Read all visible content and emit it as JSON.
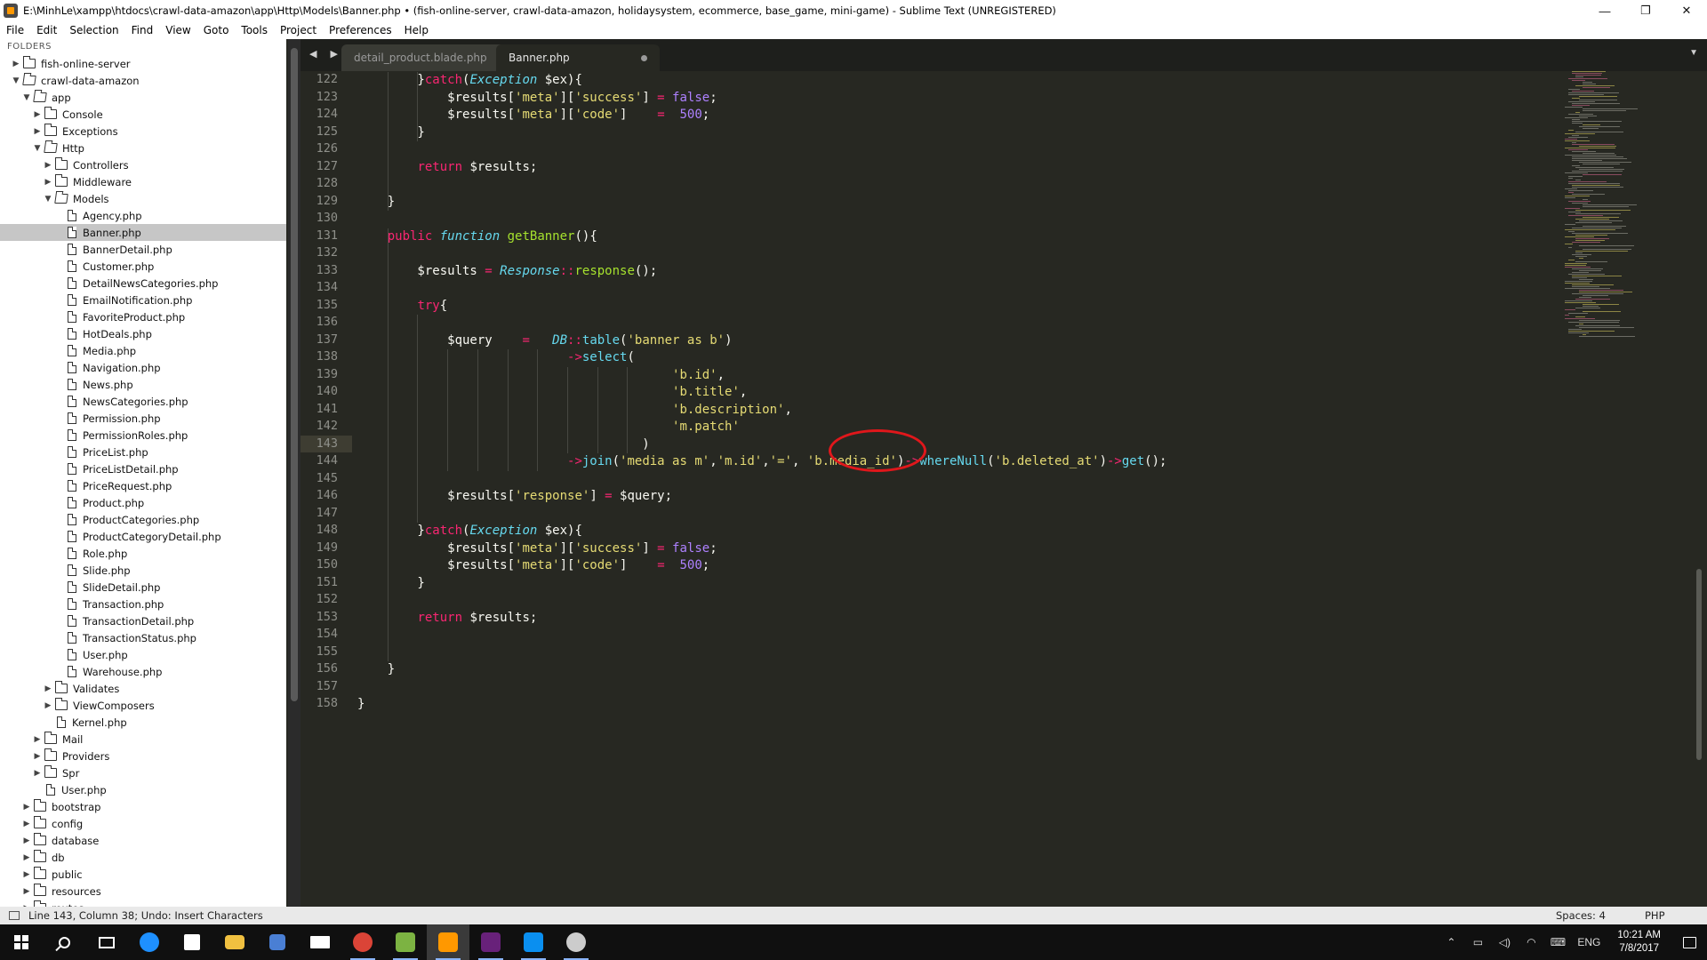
{
  "window": {
    "title": "E:\\MinhLe\\xampp\\htdocs\\crawl-data-amazon\\app\\Http\\Models\\Banner.php • (fish-online-server, crawl-data-amazon, holidaysystem, ecommerce, base_game, mini-game) - Sublime Text (UNREGISTERED)",
    "controls": {
      "minimize": "—",
      "restore": "❐",
      "close": "✕"
    }
  },
  "menu": [
    "File",
    "Edit",
    "Selection",
    "Find",
    "View",
    "Goto",
    "Tools",
    "Project",
    "Preferences",
    "Help"
  ],
  "sidebar": {
    "header": "FOLDERS",
    "tree": [
      {
        "label": "fish-online-server",
        "type": "folder",
        "depth": 0,
        "open": false
      },
      {
        "label": "crawl-data-amazon",
        "type": "folder",
        "depth": 0,
        "open": true
      },
      {
        "label": "app",
        "type": "folder",
        "depth": 1,
        "open": true
      },
      {
        "label": "Console",
        "type": "folder",
        "depth": 2,
        "open": false
      },
      {
        "label": "Exceptions",
        "type": "folder",
        "depth": 2,
        "open": false
      },
      {
        "label": "Http",
        "type": "folder",
        "depth": 2,
        "open": true
      },
      {
        "label": "Controllers",
        "type": "folder",
        "depth": 3,
        "open": false
      },
      {
        "label": "Middleware",
        "type": "folder",
        "depth": 3,
        "open": false
      },
      {
        "label": "Models",
        "type": "folder",
        "depth": 3,
        "open": true
      },
      {
        "label": "Agency.php",
        "type": "file",
        "depth": 4
      },
      {
        "label": "Banner.php",
        "type": "file",
        "depth": 4,
        "selected": true
      },
      {
        "label": "BannerDetail.php",
        "type": "file",
        "depth": 4
      },
      {
        "label": "Customer.php",
        "type": "file",
        "depth": 4
      },
      {
        "label": "DetailNewsCategories.php",
        "type": "file",
        "depth": 4
      },
      {
        "label": "EmailNotification.php",
        "type": "file",
        "depth": 4
      },
      {
        "label": "FavoriteProduct.php",
        "type": "file",
        "depth": 4
      },
      {
        "label": "HotDeals.php",
        "type": "file",
        "depth": 4
      },
      {
        "label": "Media.php",
        "type": "file",
        "depth": 4
      },
      {
        "label": "Navigation.php",
        "type": "file",
        "depth": 4
      },
      {
        "label": "News.php",
        "type": "file",
        "depth": 4
      },
      {
        "label": "NewsCategories.php",
        "type": "file",
        "depth": 4
      },
      {
        "label": "Permission.php",
        "type": "file",
        "depth": 4
      },
      {
        "label": "PermissionRoles.php",
        "type": "file",
        "depth": 4
      },
      {
        "label": "PriceList.php",
        "type": "file",
        "depth": 4
      },
      {
        "label": "PriceListDetail.php",
        "type": "file",
        "depth": 4
      },
      {
        "label": "PriceRequest.php",
        "type": "file",
        "depth": 4
      },
      {
        "label": "Product.php",
        "type": "file",
        "depth": 4
      },
      {
        "label": "ProductCategories.php",
        "type": "file",
        "depth": 4
      },
      {
        "label": "ProductCategoryDetail.php",
        "type": "file",
        "depth": 4
      },
      {
        "label": "Role.php",
        "type": "file",
        "depth": 4
      },
      {
        "label": "Slide.php",
        "type": "file",
        "depth": 4
      },
      {
        "label": "SlideDetail.php",
        "type": "file",
        "depth": 4
      },
      {
        "label": "Transaction.php",
        "type": "file",
        "depth": 4
      },
      {
        "label": "TransactionDetail.php",
        "type": "file",
        "depth": 4
      },
      {
        "label": "TransactionStatus.php",
        "type": "file",
        "depth": 4
      },
      {
        "label": "User.php",
        "type": "file",
        "depth": 4
      },
      {
        "label": "Warehouse.php",
        "type": "file",
        "depth": 4
      },
      {
        "label": "Validates",
        "type": "folder",
        "depth": 3,
        "open": false
      },
      {
        "label": "ViewComposers",
        "type": "folder",
        "depth": 3,
        "open": false
      },
      {
        "label": "Kernel.php",
        "type": "file",
        "depth": 3
      },
      {
        "label": "Mail",
        "type": "folder",
        "depth": 2,
        "open": false
      },
      {
        "label": "Providers",
        "type": "folder",
        "depth": 2,
        "open": false
      },
      {
        "label": "Spr",
        "type": "folder",
        "depth": 2,
        "open": false
      },
      {
        "label": "User.php",
        "type": "file",
        "depth": 2
      },
      {
        "label": "bootstrap",
        "type": "folder",
        "depth": 1,
        "open": false
      },
      {
        "label": "config",
        "type": "folder",
        "depth": 1,
        "open": false
      },
      {
        "label": "database",
        "type": "folder",
        "depth": 1,
        "open": false
      },
      {
        "label": "db",
        "type": "folder",
        "depth": 1,
        "open": false
      },
      {
        "label": "public",
        "type": "folder",
        "depth": 1,
        "open": false
      },
      {
        "label": "resources",
        "type": "folder",
        "depth": 1,
        "open": false
      },
      {
        "label": "routes",
        "type": "folder",
        "depth": 1,
        "open": false
      }
    ]
  },
  "tabs": {
    "nav": "◀ ▶",
    "items": [
      {
        "label": "detail_product.blade.php",
        "active": false,
        "close": "×"
      },
      {
        "label": "Banner.php",
        "active": true,
        "dirty": true
      }
    ],
    "dropdown": "▼"
  },
  "editor": {
    "current_line": 143,
    "lines": [
      {
        "n": 122,
        "tokens": [
          [
            "",
            "        }"
          ],
          [
            "k",
            "catch"
          ],
          [
            "",
            "("
          ],
          [
            "cls",
            "Exception"
          ],
          [
            "",
            " $ex){"
          ]
        ]
      },
      {
        "n": 123,
        "tokens": [
          [
            "",
            "            $results["
          ],
          [
            "st",
            "'meta'"
          ],
          [
            "",
            "]["
          ],
          [
            "st",
            "'success'"
          ],
          [
            "",
            "] "
          ],
          [
            "op",
            "="
          ],
          [
            "",
            " "
          ],
          [
            "nm",
            "false"
          ],
          [
            "",
            ";"
          ]
        ]
      },
      {
        "n": 124,
        "tokens": [
          [
            "",
            "            $results["
          ],
          [
            "st",
            "'meta'"
          ],
          [
            "",
            "]["
          ],
          [
            "st",
            "'code'"
          ],
          [
            "",
            "]    "
          ],
          [
            "op",
            "="
          ],
          [
            "",
            "  "
          ],
          [
            "nm",
            "500"
          ],
          [
            "",
            ";"
          ]
        ]
      },
      {
        "n": 125,
        "tokens": [
          [
            "",
            "        }"
          ]
        ]
      },
      {
        "n": 126,
        "tokens": []
      },
      {
        "n": 127,
        "tokens": [
          [
            "",
            "        "
          ],
          [
            "k",
            "return"
          ],
          [
            "",
            " $results;"
          ]
        ]
      },
      {
        "n": 128,
        "tokens": []
      },
      {
        "n": 129,
        "tokens": [
          [
            "",
            "    }"
          ]
        ]
      },
      {
        "n": 130,
        "tokens": []
      },
      {
        "n": 131,
        "tokens": [
          [
            "",
            "    "
          ],
          [
            "k",
            "public"
          ],
          [
            "",
            " "
          ],
          [
            "kf",
            "function"
          ],
          [
            "",
            " "
          ],
          [
            "fn",
            "getBanner"
          ],
          [
            "",
            "(){"
          ]
        ]
      },
      {
        "n": 132,
        "tokens": []
      },
      {
        "n": 133,
        "tokens": [
          [
            "",
            "        $results "
          ],
          [
            "op",
            "="
          ],
          [
            "",
            " "
          ],
          [
            "cls",
            "Response"
          ],
          [
            "op",
            "::"
          ],
          [
            "fn",
            "response"
          ],
          [
            "",
            "();"
          ]
        ]
      },
      {
        "n": 134,
        "tokens": []
      },
      {
        "n": 135,
        "tokens": [
          [
            "",
            "        "
          ],
          [
            "k",
            "try"
          ],
          [
            "",
            "{"
          ]
        ]
      },
      {
        "n": 136,
        "tokens": []
      },
      {
        "n": 137,
        "tokens": [
          [
            "",
            "            $query    "
          ],
          [
            "op",
            "="
          ],
          [
            "",
            "   "
          ],
          [
            "cls",
            "DB"
          ],
          [
            "op",
            "::"
          ],
          [
            "mth",
            "table"
          ],
          [
            "",
            "("
          ],
          [
            "st",
            "'banner as b'"
          ],
          [
            "",
            ")"
          ]
        ]
      },
      {
        "n": 138,
        "tokens": [
          [
            "",
            "                            "
          ],
          [
            "op",
            "->"
          ],
          [
            "mth",
            "select"
          ],
          [
            "",
            "("
          ]
        ]
      },
      {
        "n": 139,
        "tokens": [
          [
            "",
            "                                          "
          ],
          [
            "st",
            "'b.id'"
          ],
          [
            "",
            ","
          ]
        ]
      },
      {
        "n": 140,
        "tokens": [
          [
            "",
            "                                          "
          ],
          [
            "st",
            "'b.title'"
          ],
          [
            "",
            ","
          ]
        ]
      },
      {
        "n": 141,
        "tokens": [
          [
            "",
            "                                          "
          ],
          [
            "st",
            "'b.description'"
          ],
          [
            "",
            ","
          ]
        ]
      },
      {
        "n": 142,
        "tokens": [
          [
            "",
            "                                          "
          ],
          [
            "st",
            "'m.patch'"
          ]
        ]
      },
      {
        "n": 143,
        "tokens": [
          [
            "",
            "                                      )"
          ]
        ]
      },
      {
        "n": 144,
        "tokens": [
          [
            "",
            "                            "
          ],
          [
            "op",
            "->"
          ],
          [
            "mth",
            "join"
          ],
          [
            "",
            "("
          ],
          [
            "st",
            "'media as m'"
          ],
          [
            "",
            ","
          ],
          [
            "st",
            "'m.id'"
          ],
          [
            "",
            ","
          ],
          [
            "st",
            "'='"
          ],
          [
            "",
            ", "
          ],
          [
            "st",
            "'b.media_id'"
          ],
          [
            "",
            ")"
          ],
          [
            "op",
            "->"
          ],
          [
            "mth",
            "whereNull"
          ],
          [
            "",
            "("
          ],
          [
            "st",
            "'b.deleted_at'"
          ],
          [
            "",
            ")"
          ],
          [
            "op",
            "->"
          ],
          [
            "mth",
            "get"
          ],
          [
            "",
            "();"
          ]
        ]
      },
      {
        "n": 145,
        "tokens": []
      },
      {
        "n": 146,
        "tokens": [
          [
            "",
            "            $results["
          ],
          [
            "st",
            "'response'"
          ],
          [
            "",
            "] "
          ],
          [
            "op",
            "="
          ],
          [
            "",
            " $query;"
          ]
        ]
      },
      {
        "n": 147,
        "tokens": []
      },
      {
        "n": 148,
        "tokens": [
          [
            "",
            "        }"
          ],
          [
            "k",
            "catch"
          ],
          [
            "",
            "("
          ],
          [
            "cls",
            "Exception"
          ],
          [
            "",
            " $ex){"
          ]
        ]
      },
      {
        "n": 149,
        "tokens": [
          [
            "",
            "            $results["
          ],
          [
            "st",
            "'meta'"
          ],
          [
            "",
            "]["
          ],
          [
            "st",
            "'success'"
          ],
          [
            "",
            "] "
          ],
          [
            "op",
            "="
          ],
          [
            "",
            " "
          ],
          [
            "nm",
            "false"
          ],
          [
            "",
            ";"
          ]
        ]
      },
      {
        "n": 150,
        "tokens": [
          [
            "",
            "            $results["
          ],
          [
            "st",
            "'meta'"
          ],
          [
            "",
            "]["
          ],
          [
            "st",
            "'code'"
          ],
          [
            "",
            "]    "
          ],
          [
            "op",
            "="
          ],
          [
            "",
            "  "
          ],
          [
            "nm",
            "500"
          ],
          [
            "",
            ";"
          ]
        ]
      },
      {
        "n": 151,
        "tokens": [
          [
            "",
            "        }"
          ]
        ]
      },
      {
        "n": 152,
        "tokens": []
      },
      {
        "n": 153,
        "tokens": [
          [
            "",
            "        "
          ],
          [
            "k",
            "return"
          ],
          [
            "",
            " $results;"
          ]
        ]
      },
      {
        "n": 154,
        "tokens": []
      },
      {
        "n": 155,
        "tokens": []
      },
      {
        "n": 156,
        "tokens": [
          [
            "",
            "    }"
          ]
        ]
      },
      {
        "n": 157,
        "tokens": []
      },
      {
        "n": 158,
        "tokens": [
          [
            "",
            "}"
          ]
        ]
      }
    ]
  },
  "status": {
    "left": "Line 143, Column 38; Undo: Insert Characters",
    "spaces": "Spaces: 4",
    "syntax": "PHP"
  },
  "taskbar": {
    "apps": [
      "start-icon",
      "search-icon",
      "task-view-icon",
      "edge-icon",
      "store-icon",
      "file-explorer-icon",
      "network-tool-icon",
      "mail-icon",
      "chrome-icon",
      "bluestacks-icon",
      "sublime-text-icon",
      "visual-studio-icon",
      "zalo-icon",
      "paint-icon"
    ],
    "tray": {
      "lang": "ENG",
      "time": "10:21 AM",
      "date": "7/8/2017"
    },
    "colors": {
      "edge": "#1e90ff",
      "store": "#ffffff",
      "explorer": "#f0c040",
      "mail": "#ffffff",
      "chrome": "#db4437",
      "bluestacks": "#7cb342",
      "sublime": "#ff9800",
      "vs": "#68217a",
      "zalo": "#0a8ff0",
      "paint": "#cccccc"
    }
  }
}
